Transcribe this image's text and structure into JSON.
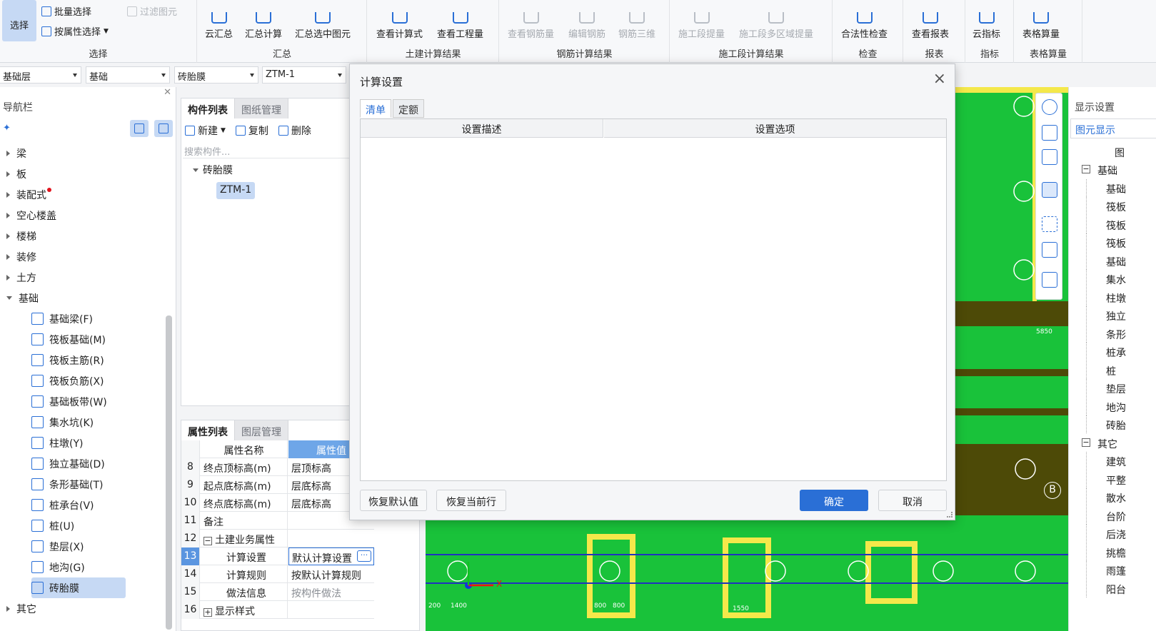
{
  "ribbon": {
    "select_group": {
      "label": "选择",
      "select_btn": "选择",
      "batch_select": "批量选择",
      "filter_elements": "过滤图元",
      "attr_select": "按属性选择"
    },
    "summary_group": {
      "label": "汇总",
      "cloud_summary": "云汇总",
      "summary_calc": "汇总计算",
      "summary_selected": "汇总选中图元"
    },
    "civil_group": {
      "label": "土建计算结果",
      "view_formula": "查看计算式",
      "view_quantity": "查看工程量"
    },
    "rebar_group": {
      "label": "钢筋计算结果",
      "view_rebar": "查看钢筋量",
      "edit_rebar": "编辑钢筋",
      "rebar_3d": "钢筋三维"
    },
    "section_group": {
      "label": "施工段计算结果",
      "section_extract": "施工段提量",
      "multi_region": "施工段多区域提量"
    },
    "check_group": {
      "label": "检查",
      "legality": "合法性检查"
    },
    "report_group": {
      "label": "报表",
      "view_report": "查看报表"
    },
    "index_group": {
      "label": "指标",
      "cloud_index": "云指标"
    },
    "table_group": {
      "label": "表格算量",
      "table_calc": "表格算量"
    }
  },
  "dropdowns": [
    "基础层",
    "基础",
    "砖胎膜",
    "ZTM-1"
  ],
  "nav": {
    "title": "导航栏",
    "categories": [
      {
        "label": "梁",
        "open": false
      },
      {
        "label": "板",
        "open": false
      },
      {
        "label": "装配式",
        "open": false,
        "dot": true
      },
      {
        "label": "空心楼盖",
        "open": false
      },
      {
        "label": "楼梯",
        "open": false
      },
      {
        "label": "装修",
        "open": false
      },
      {
        "label": "土方",
        "open": false
      },
      {
        "label": "基础",
        "open": true
      }
    ],
    "foundation_items": [
      "基础梁(F)",
      "筏板基础(M)",
      "筏板主筋(R)",
      "筏板负筋(X)",
      "基础板带(W)",
      "集水坑(K)",
      "柱墩(Y)",
      "独立基础(D)",
      "条形基础(T)",
      "桩承台(V)",
      "桩(U)",
      "垫层(X)",
      "地沟(G)",
      "砖胎膜"
    ],
    "selected_item": "砖胎膜",
    "last_category": "其它"
  },
  "component_panel": {
    "tabs": [
      "构件列表",
      "图纸管理"
    ],
    "tools": {
      "new": "新建",
      "copy": "复制",
      "delete": "删除"
    },
    "search_placeholder": "搜索构件...",
    "tree_root": "砖胎膜",
    "tree_item": "ZTM-1"
  },
  "property_panel": {
    "tabs": [
      "属性列表",
      "图层管理"
    ],
    "header": {
      "name": "属性名称",
      "value": "属性值"
    },
    "rows": [
      {
        "no": "8",
        "name": "终点顶标高(m)",
        "value": "层顶标高"
      },
      {
        "no": "9",
        "name": "起点底标高(m)",
        "value": "层底标高"
      },
      {
        "no": "10",
        "name": "终点底标高(m)",
        "value": "层底标高"
      },
      {
        "no": "11",
        "name": "备注",
        "value": ""
      },
      {
        "no": "12",
        "name": "土建业务属性",
        "value": ""
      },
      {
        "no": "13",
        "name": "计算设置",
        "value": "默认计算设置"
      },
      {
        "no": "14",
        "name": "计算规则",
        "value": "按默认计算规则"
      },
      {
        "no": "15",
        "name": "做法信息",
        "value": "按构件做法"
      },
      {
        "no": "16",
        "name": "显示样式",
        "value": ""
      }
    ],
    "selected_row": "13",
    "more_button": "···"
  },
  "dialog": {
    "title": "计算设置",
    "close": "×",
    "tabs": [
      "清单",
      "定额"
    ],
    "active_tab": "清单",
    "columns": [
      "设置描述",
      "设置选项"
    ],
    "buttons": {
      "restore_default": "恢复默认值",
      "restore_row": "恢复当前行",
      "ok": "确定",
      "cancel": "取消"
    }
  },
  "display_panel": {
    "title": "显示设置",
    "tab": "图元显示",
    "header_fragment": "图",
    "rows": [
      {
        "label": "基础",
        "group": true
      },
      {
        "label": "基础",
        "group": false
      },
      {
        "label": "筏板",
        "group": false
      },
      {
        "label": "筏板",
        "group": false
      },
      {
        "label": "筏板",
        "group": false
      },
      {
        "label": "基础",
        "group": false
      },
      {
        "label": "集水",
        "group": false
      },
      {
        "label": "柱墩",
        "group": false
      },
      {
        "label": "独立",
        "group": false
      },
      {
        "label": "条形",
        "group": false
      },
      {
        "label": "桩承",
        "group": false
      },
      {
        "label": "桩",
        "group": false
      },
      {
        "label": "垫层",
        "group": false
      },
      {
        "label": "地沟",
        "group": false
      },
      {
        "label": "砖胎",
        "group": false
      },
      {
        "label": "其它",
        "group": true
      },
      {
        "label": "建筑",
        "group": false
      },
      {
        "label": "平整",
        "group": false
      },
      {
        "label": "散水",
        "group": false
      },
      {
        "label": "台阶",
        "group": false
      },
      {
        "label": "后浇",
        "group": false
      },
      {
        "label": "挑檐",
        "group": false
      },
      {
        "label": "雨篷",
        "group": false
      },
      {
        "label": "阳台",
        "group": false
      }
    ]
  },
  "canvas": {
    "marker_b": "B",
    "axis_x": "X",
    "dims": [
      "5850",
      "200",
      "1400",
      "800",
      "800",
      "1550"
    ]
  },
  "colors": {
    "accent": "#2a6fd6",
    "cad_bg": "#4d4a07",
    "cad_green": "#19c23a",
    "cad_yellow": "#f4e84a"
  }
}
